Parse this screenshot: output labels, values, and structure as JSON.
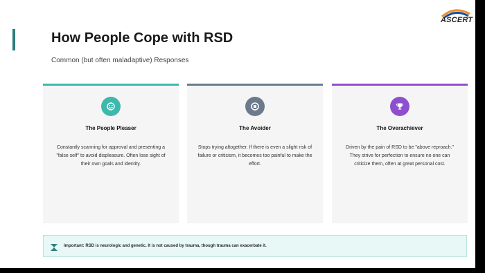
{
  "slide": {
    "title": "How People Cope with RSD",
    "subtitle": "Common (but often maladaptive) Responses",
    "logo_text": "ASCERT"
  },
  "cards": [
    {
      "title": "The People Pleaser",
      "text": "Constantly scanning for approval and presenting a \"false self\" to avoid displeasure. Often lose sight of their own goals and identity.",
      "icon": "smile-icon",
      "color": "#3fb8ac"
    },
    {
      "title": "The Avoider",
      "text": "Stops trying altogether. If there is even a slight risk of failure or criticism, it becomes too painful to make the effort.",
      "icon": "stop-circle-icon",
      "color": "#6b7a8c"
    },
    {
      "title": "The Overachiever",
      "text": "Driven by the pain of RSD to be \"above reproach.\" They strive for perfection to ensure no one can criticize them, often at great personal cost.",
      "icon": "trophy-icon",
      "color": "#8e4fcf"
    }
  ],
  "notice": {
    "icon": "hourglass-icon",
    "text": "Important: RSD is neurologic and genetic. It is not caused by trauma, though trauma can exacerbate it."
  },
  "colors": {
    "accent": "#2a7d7b",
    "notice_bg": "#e8f8f6"
  }
}
